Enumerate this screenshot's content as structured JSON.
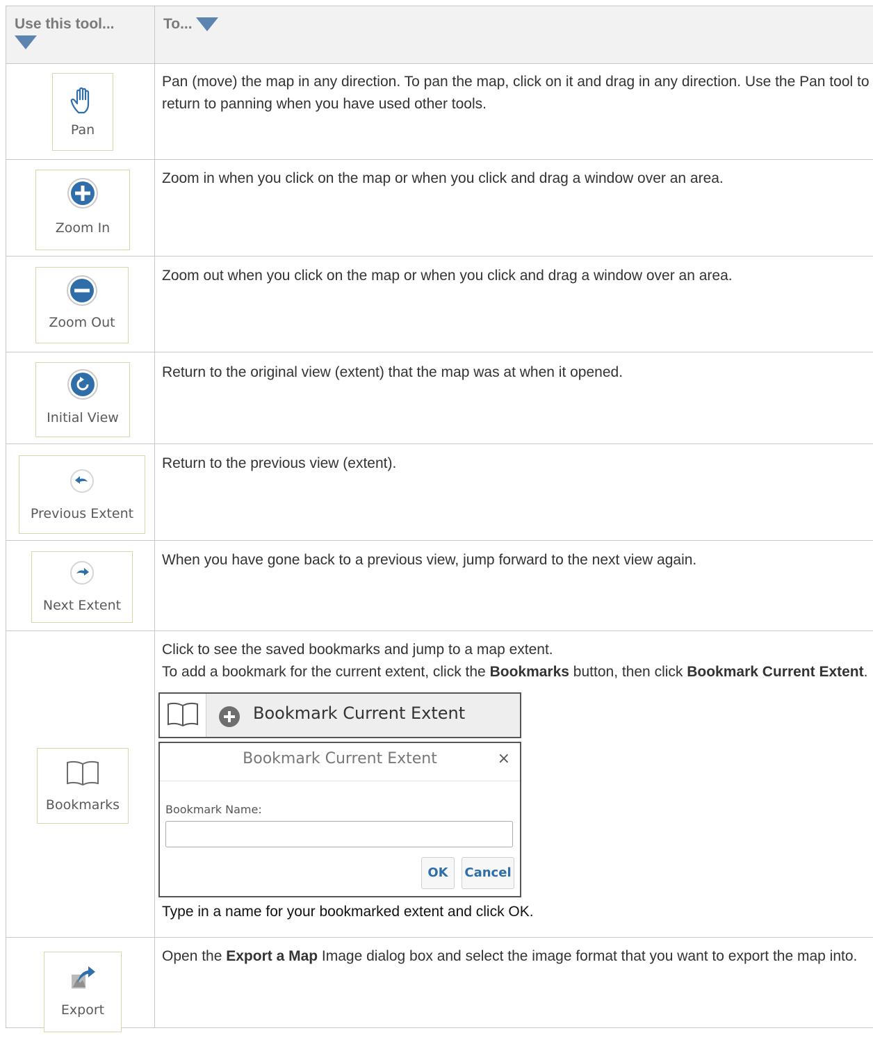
{
  "header": {
    "tool_col": "Use this tool...",
    "desc_col": "To..."
  },
  "rows": [
    {
      "tool": "Pan",
      "icon": "hand-icon",
      "desc": "Pan (move) the map in any direction. To pan the map, click on it and drag in any direction. Use the Pan tool to return to panning when you have used other tools."
    },
    {
      "tool": "Zoom In",
      "icon": "plus-circle-icon",
      "desc": "Zoom in when you click on the map or when you click and drag a window over an area."
    },
    {
      "tool": "Zoom Out",
      "icon": "minus-circle-icon",
      "desc": "Zoom out when you click on the map or when you click and drag a window over an area."
    },
    {
      "tool": "Initial View",
      "icon": "refresh-icon",
      "desc": "Return to the original view (extent) that the map was at when it opened."
    },
    {
      "tool": "Previous Extent",
      "icon": "arrow-left-icon",
      "desc": "Return to the previous view (extent)."
    },
    {
      "tool": "Next Extent",
      "icon": "arrow-right-icon",
      "desc": "When you have gone back to a previous view, jump forward to the next view again."
    },
    {
      "tool": "Bookmarks",
      "icon": "book-icon",
      "desc_line1": "Click to see the saved bookmarks and jump to a map extent.",
      "desc_line2_pre": "To add a bookmark for the current extent, click the ",
      "desc_line2_b1": "Bookmarks",
      "desc_line2_mid": " button, then click ",
      "desc_line2_b2": "Bookmark Current Extent",
      "desc_line2_end": ".",
      "bar_label": "Bookmark Current Extent",
      "dialog": {
        "title": "Bookmark Current Extent",
        "close": "×",
        "name_label": "Bookmark Name:",
        "name_value": "",
        "ok": "OK",
        "cancel": "Cancel"
      },
      "desc_after": "Type in a name for your bookmarked extent and click OK."
    },
    {
      "tool": "Export",
      "icon": "export-icon",
      "desc_pre": "Open the ",
      "desc_b": "Export a Map",
      "desc_post": " Image dialog box and select the image format that you want to export the map into."
    }
  ],
  "colors": {
    "accent": "#2f6ea8",
    "triangle": "#5b84b1",
    "header_bg": "#f2f2f2",
    "button_border": "#d9d6a8"
  }
}
